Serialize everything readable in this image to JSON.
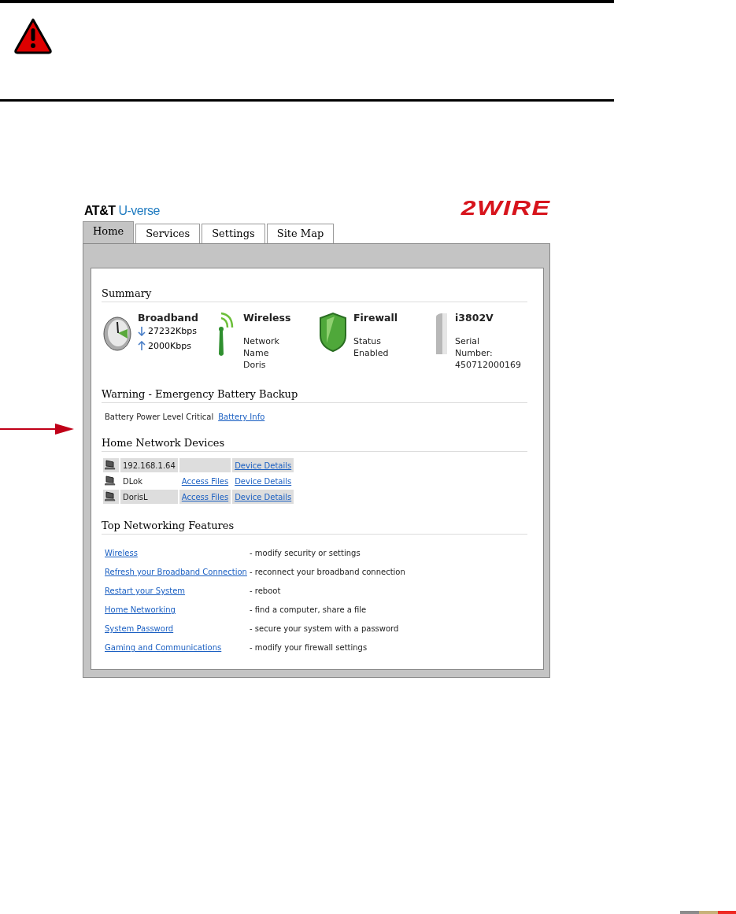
{
  "brand": {
    "left": "AT&T",
    "left_accent": "U-verse",
    "right": "2WIRE"
  },
  "tabs": [
    {
      "label": "Home",
      "selected": true
    },
    {
      "label": "Services",
      "selected": false
    },
    {
      "label": "Settings",
      "selected": false
    },
    {
      "label": "Site Map",
      "selected": false
    }
  ],
  "summary": {
    "title": "Summary",
    "items": [
      {
        "kind": "broadband",
        "title": "Broadband",
        "down": "27232Kbps",
        "up": "2000Kbps"
      },
      {
        "kind": "wireless",
        "title": "Wireless",
        "lines": [
          "Network",
          "Name",
          "Doris"
        ]
      },
      {
        "kind": "firewall",
        "title": "Firewall",
        "lines": [
          "Status",
          "Enabled"
        ]
      },
      {
        "kind": "device",
        "title": "i3802V",
        "lines": [
          "Serial",
          "Number:",
          "450712000169"
        ]
      }
    ]
  },
  "warning": {
    "title": "Warning - Emergency Battery Backup",
    "text": "Battery Power Level Critical",
    "link": "Battery Info"
  },
  "devices": {
    "title": "Home Network Devices",
    "rows": [
      {
        "name": "192.168.1.64",
        "details": "Device Details"
      },
      {
        "name": "DLok",
        "access": "Access Files",
        "details": "Device Details"
      },
      {
        "name": "DorisL",
        "access": "Access Files",
        "details": "Device Details"
      }
    ]
  },
  "features": {
    "title": "Top Networking Features",
    "rows": [
      {
        "link": "Wireless",
        "desc": "- modify security or settings"
      },
      {
        "link": "Refresh your Broadband Connection",
        "desc": "- reconnect your broadband connection"
      },
      {
        "link": "Restart your System",
        "desc": "- reboot"
      },
      {
        "link": "Home Networking",
        "desc": "- find a computer, share a file"
      },
      {
        "link": "System Password",
        "desc": "- secure your system with a password"
      },
      {
        "link": "Gaming and Communications",
        "desc": "- modify your firewall settings"
      }
    ]
  }
}
